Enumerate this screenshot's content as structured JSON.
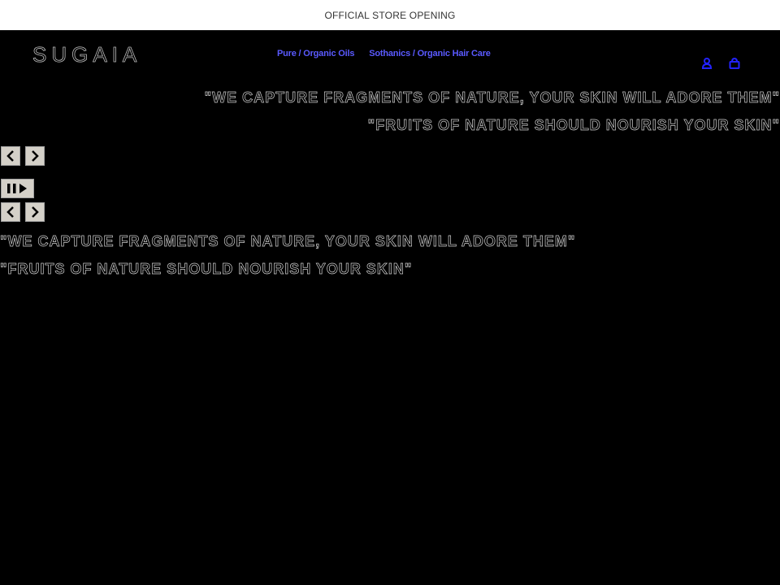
{
  "announcement": {
    "text": "OFFICIAL STORE OPENING"
  },
  "header": {
    "logo": "SUGAIA",
    "nav": [
      {
        "label": "Pure / Organic Oils"
      },
      {
        "label": "Sothanics / Organic Hair Care"
      }
    ],
    "icons": [
      "account-icon",
      "cart-icon"
    ],
    "accent_color": "#5a5aff"
  },
  "slideshow_top": {
    "lines": [
      "\"WE CAPTURE FRAGMENTS OF NATURE, YOUR SKIN WILL ADORE THEM\"",
      "\"FRUITS OF NATURE SHOULD NOURISH YOUR SKIN\""
    ],
    "controls": {
      "prev_label": "Previous slide",
      "next_label": "Next slide"
    }
  },
  "slideshow_bottom": {
    "controls": {
      "pause_play_label": "Pause/Play",
      "prev_label": "Previous slide",
      "next_label": "Next slide"
    },
    "lines": [
      "\"WE CAPTURE FRAGMENTS OF NATURE, YOUR SKIN WILL ADORE THEM\"",
      "\"FRUITS OF NATURE SHOULD NOURISH YOUR SKIN\""
    ]
  }
}
